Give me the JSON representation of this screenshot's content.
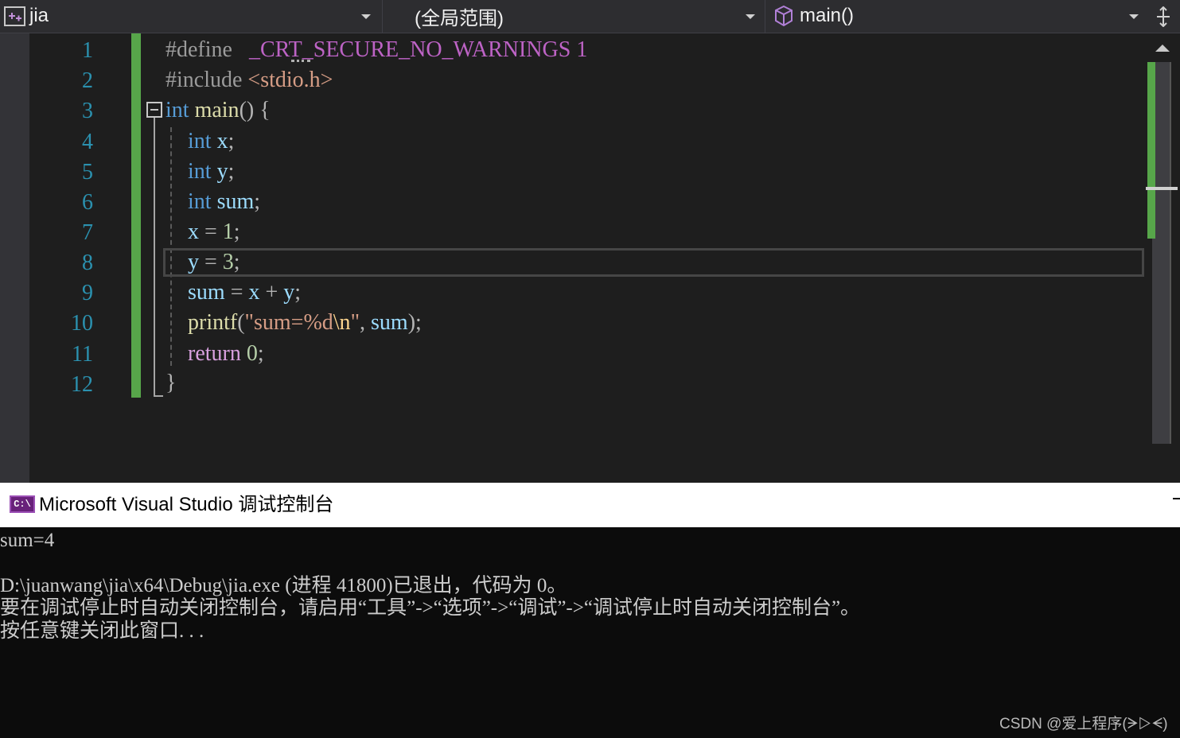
{
  "navbar": {
    "project": "jia",
    "scope": "(全局范围)",
    "member": "main()"
  },
  "editor": {
    "line_numbers": [
      "1",
      "2",
      "3",
      "4",
      "5",
      "6",
      "7",
      "8",
      "9",
      "10",
      "11",
      "12"
    ],
    "lines": [
      "#define   _CRT_SECURE_NO_WARNINGS 1",
      "#include <stdio.h>",
      "int main() {",
      "    int x;",
      "    int y;",
      "    int sum;",
      "    x = 1;",
      "    y = 3;",
      "    sum = x + y;",
      "    printf(\"sum=%d\\n\", sum);",
      "    return 0;",
      "}"
    ],
    "current_line": 8,
    "tokens": {
      "define": "#define",
      "macro": "_CRT_SECURE_NO_WARNINGS",
      "one": "1",
      "include": "#include",
      "header": "<stdio.h>",
      "int": "int",
      "main": "main",
      "parens": "()",
      "brace_open": "{",
      "x": "x",
      "y": "y",
      "sum": "sum",
      "semi": ";",
      "eq": "=",
      "plus": "+",
      "num1": "1",
      "num3": "3",
      "printf": "printf",
      "lparen": "(",
      "rparen": ")",
      "fmt_open": "\"sum=%d",
      "esc": "\\n",
      "fmt_close": "\"",
      "comma": ",",
      "return": "return",
      "zero": "0",
      "brace_close": "}"
    }
  },
  "console": {
    "title": "Microsoft Visual Studio 调试控制台",
    "icon_label": "C:\\",
    "lines": [
      "sum=4",
      "",
      "D:\\juanwang\\jia\\x64\\Debug\\jia.exe (进程 41800)已退出，代码为 0。",
      "要在调试停止时自动关闭控制台，请启用“工具”->“选项”->“调试”->“调试停止时自动关闭控制台”。",
      "按任意键关闭此窗口. . ."
    ]
  },
  "watermark": "CSDN @爱上程序(ᗒ▷ᗕ)",
  "colors": {
    "background": "#1e1e1e",
    "change_bar": "#57a64a",
    "keyword": "#569cd6",
    "line_number": "#2b91af"
  }
}
